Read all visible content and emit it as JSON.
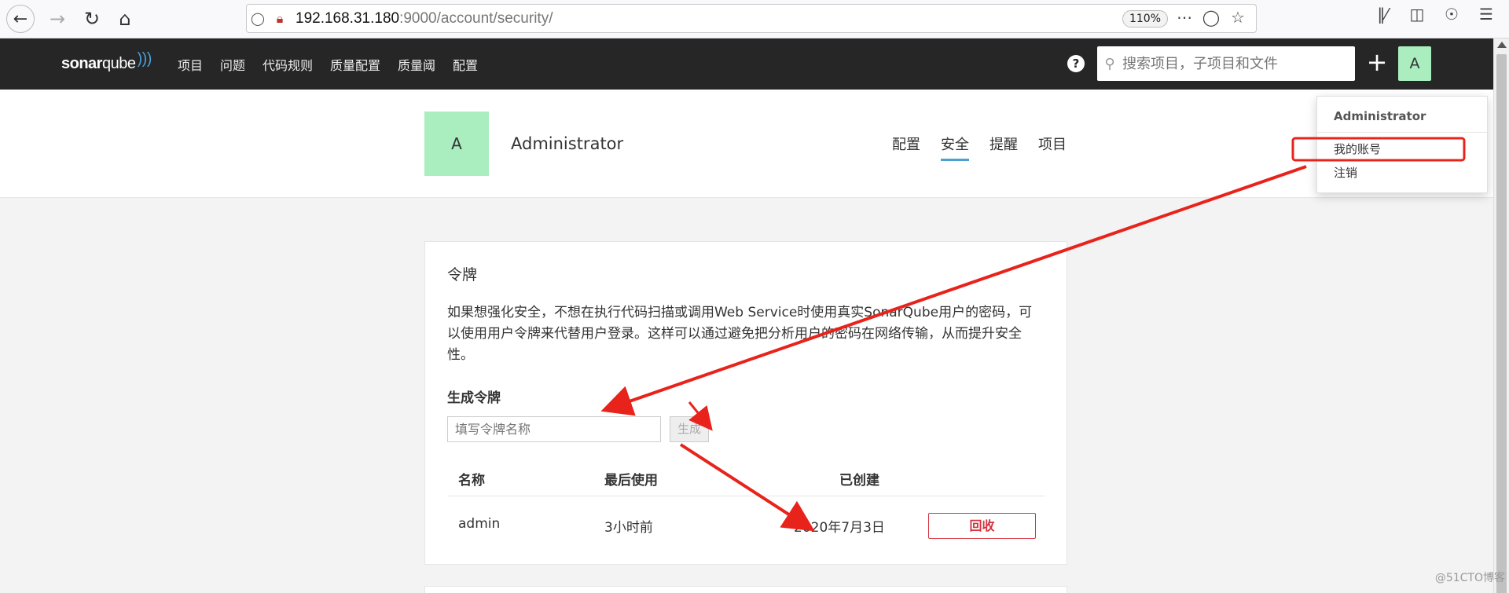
{
  "browser": {
    "url_host": "192.168.31.180",
    "url_rest": ":9000/account/security/",
    "zoom": "110%",
    "nav_icons": [
      "back-arrow-icon",
      "forward-arrow-icon",
      "reload-icon",
      "home-icon"
    ],
    "url_icons": [
      "shield-icon",
      "insecure-lock-icon"
    ],
    "action_icons": [
      "more-icon",
      "pocket-icon",
      "star-icon"
    ],
    "toolbar_icons": [
      "library-icon",
      "sidebar-icon",
      "account-icon",
      "menu-icon"
    ]
  },
  "sonar_nav": {
    "logo_a": "sonar",
    "logo_b": "qube",
    "items": [
      "项目",
      "问题",
      "代码规则",
      "质量配置",
      "质量阈",
      "配置"
    ],
    "search_placeholder": "搜索项目，子项目和文件",
    "plus": "+",
    "avatar": "A"
  },
  "account": {
    "avatar": "A",
    "name": "Administrator",
    "tabs": [
      {
        "label": "配置",
        "active": false
      },
      {
        "label": "安全",
        "active": true
      },
      {
        "label": "提醒",
        "active": false
      },
      {
        "label": "项目",
        "active": false
      }
    ]
  },
  "dropdown": {
    "user": "Administrator",
    "items": [
      "我的账号",
      "注销"
    ]
  },
  "tokens": {
    "title": "令牌",
    "description": "如果想强化安全，不想在执行代码扫描或调用Web Service时使用真实SonarQube用户的密码，可以使用用户令牌来代替用户登录。这样可以通过避免把分析用户的密码在网络传输，从而提升安全性。",
    "generate_title": "生成令牌",
    "input_placeholder": "填写令牌名称",
    "generate_button": "生成",
    "columns": [
      "名称",
      "最后使用",
      "已创建"
    ],
    "rows": [
      {
        "name": "admin",
        "last_used": "3小时前",
        "created": "2020年7月3日",
        "action": "回收"
      }
    ]
  },
  "annotation_color": "#e8231b",
  "watermark": "@51CTO博客"
}
